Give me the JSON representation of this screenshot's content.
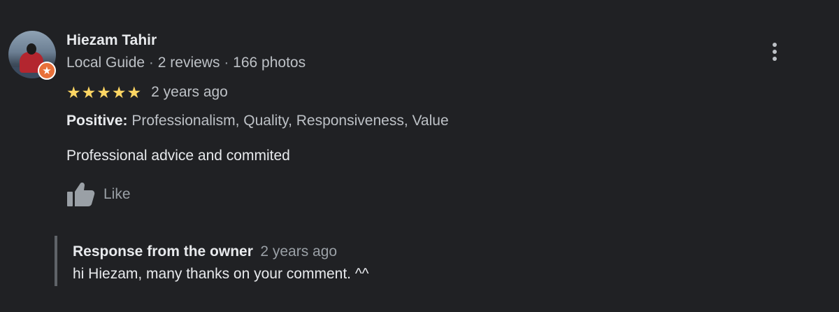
{
  "reviewer": {
    "name": "Hiezam Tahir",
    "badge": "Local Guide",
    "separator": "·",
    "reviews": "2 reviews",
    "photos": "166 photos",
    "badge_icon": "star-badge-icon",
    "badge_color": "#e8703a"
  },
  "review": {
    "rating": 5,
    "rating_max": 5,
    "star_glyph": "★",
    "star_color": "#fdd663",
    "time": "2 years ago",
    "positive_label": "Positive:",
    "positive_values": "Professionalism, Quality, Responsiveness, Value",
    "text": "Professional advice and commited",
    "like_label": "Like"
  },
  "owner_response": {
    "title": "Response from the owner",
    "time": "2 years ago",
    "text": "hi Hiezam, many thanks on your comment. ^^"
  },
  "colors": {
    "background": "#202124",
    "primary_text": "#e8eaed",
    "secondary_text": "#bdc1c6",
    "muted_text": "#9aa0a6"
  }
}
